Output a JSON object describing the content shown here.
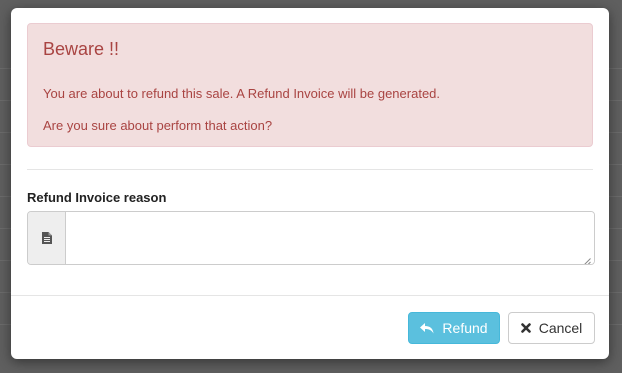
{
  "alert": {
    "title": "Beware !!",
    "message": "You are about to refund this sale. A Refund Invoice will be generated.",
    "question": "Are you sure about perform that action?"
  },
  "form": {
    "reason_label": "Refund Invoice reason",
    "reason_value": "",
    "addon_icon": "file-icon"
  },
  "footer": {
    "refund_label": "Refund",
    "refund_icon": "reply-icon",
    "cancel_label": "Cancel",
    "cancel_icon": "close-icon"
  },
  "colors": {
    "alert_bg": "#f2dede",
    "alert_text": "#a94442",
    "refund_bg": "#5bc0de"
  }
}
